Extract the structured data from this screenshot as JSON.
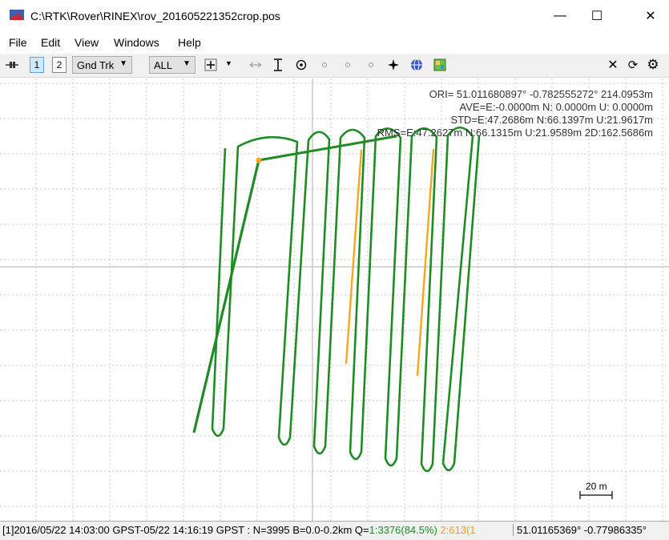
{
  "window": {
    "title": "C:\\RTK\\Rover\\RINEX\\rov_201605221352crop.pos",
    "minimize_glyph": "—",
    "maximize_glyph": "☐",
    "close_glyph": "✕"
  },
  "menu": [
    "File",
    "Edit",
    "View",
    "Windows",
    "Help"
  ],
  "toolbar": {
    "layout_1": "1",
    "layout_2": "2",
    "plot_type": "Gnd Trk",
    "quality_filter": "ALL",
    "icons": [
      "center-origin-icon",
      "dropdown-arrow-icon",
      "fit-horizontal-icon",
      "fit-vertical-icon",
      "center-target-icon",
      "dot-icon",
      "dot-icon",
      "dot-icon",
      "compass-icon",
      "globe-icon",
      "map-layer-icon",
      "close-icon",
      "reload-icon",
      "settings-icon"
    ]
  },
  "plot": {
    "ori": "ORI= 51.011680897°  -0.782555272° 214.0953m",
    "ave": "AVE=E:-0.0000m N: 0.0000m U: 0.0000m",
    "std": "STD=E:47.2686m N:66.1397m U:21.9617m",
    "rms": "RMS=E:47.2627m N:66.1315m U:21.9589m 2D:162.5686m",
    "scale_label": "20 m",
    "colors": {
      "fix": "#1f8b24",
      "float": "#f5a623",
      "grid": "#c8c8c8"
    }
  },
  "status": {
    "left_main": "[1]2016/05/22 14:03:00 GPST-05/22 14:16:19 GPST : N=3995 B=0.0-0.2km Q=",
    "q1": "1:3376(84.5%)",
    "q2": "2:613(1",
    "right_coords": "51.01165369°  -0.77986335°"
  }
}
